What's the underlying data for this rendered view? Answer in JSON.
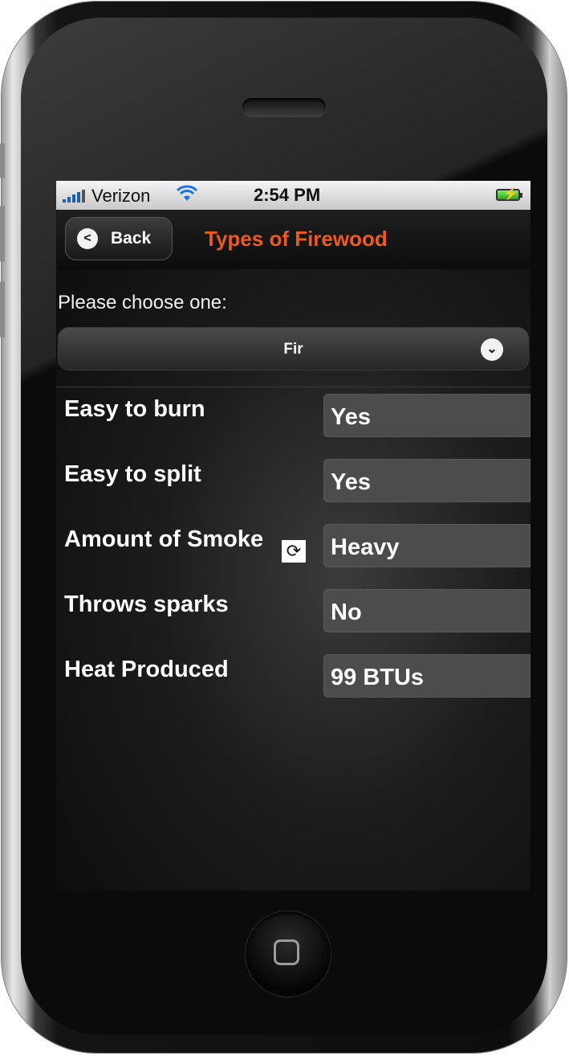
{
  "status_bar": {
    "carrier": "Verizon",
    "time": "2:54 PM"
  },
  "nav_bar": {
    "back_label": "Back",
    "title": "Types of Firewood"
  },
  "picker": {
    "prompt": "Please choose one:",
    "selected": "Fir"
  },
  "properties": [
    {
      "label": "Easy to burn",
      "value": "Yes"
    },
    {
      "label": "Easy to split",
      "value": "Yes"
    },
    {
      "label": "Amount of Smoke",
      "value": "Heavy"
    },
    {
      "label": "Throws sparks",
      "value": "No"
    },
    {
      "label": "Heat Produced",
      "value": "99 BTUs"
    }
  ],
  "colors": {
    "title_accent": "#ee5a1c"
  },
  "icons": [
    "signal-icon",
    "wifi-icon",
    "battery-icon",
    "back-chevron-icon",
    "dropdown-chevron-icon",
    "sync-icon",
    "home-button-icon"
  ]
}
